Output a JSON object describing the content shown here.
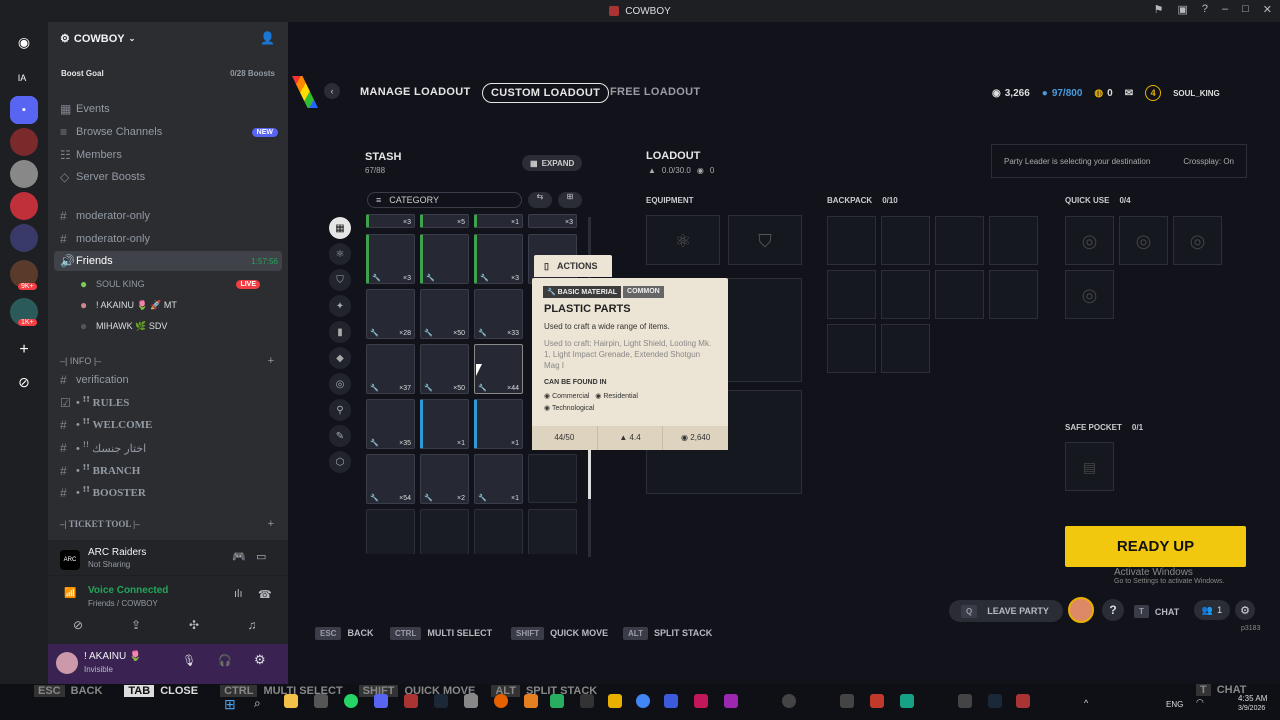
{
  "window": {
    "title": "COWBOY"
  },
  "server": {
    "name": "COWBOY",
    "boost_goal_label": "Boost Goal",
    "boost_count": "0/28 Boosts"
  },
  "sidebar": {
    "top_items": [
      "Events",
      "Browse Channels",
      "Members",
      "Server Boosts"
    ],
    "new_badge": "NEW",
    "channels": [
      "moderator-only",
      "moderator-only"
    ],
    "friends_channel": "Friends",
    "friends_timer": "1:57:56",
    "voice_users": [
      {
        "name": "SOUL KING",
        "badge": "LIVE"
      },
      {
        "name": "! AKAINU 🌷 🚀 MT",
        "badge": ""
      },
      {
        "name": "MIHAWK 🌿 SDV",
        "badge": ""
      }
    ],
    "info_category": "–| INFO |–",
    "info_channels": [
      "verification",
      "• ꜝꜝ RULES",
      "• ꜝꜝ WELCOME",
      "• ꜝꜝ اختار جنسك",
      "• ꜝꜝ BRANCH",
      "• ꜝꜝ BOOSTER"
    ],
    "ticket_category": "–| TICKET TOOL |–"
  },
  "activity": {
    "name": "ARC Raiders",
    "status": "Not Sharing"
  },
  "voice": {
    "status": "Voice Connected",
    "channel": "Friends / COWBOY"
  },
  "user": {
    "name": "! AKAINU 🌷",
    "status": "Invisible"
  },
  "rail_badges": [
    "9K+",
    "1K+"
  ],
  "game": {
    "nav": {
      "manage": "MANAGE LOADOUT",
      "custom": "CUSTOM LOADOUT",
      "free": "FREE LOADOUT"
    },
    "currency": {
      "coins": "3,266",
      "raider": "97/800",
      "tokens": "0",
      "level": "4",
      "username": "SOUL_KING"
    },
    "stash": {
      "title": "STASH",
      "count": "67/88",
      "expand": "EXPAND",
      "category": "CATEGORY"
    },
    "loadout": {
      "title": "LOADOUT",
      "weight": "0.0/30.0",
      "value": "0"
    },
    "party_info": "Party Leader is selecting your destination",
    "crossplay": "Crossplay: On",
    "equipment_label": "EQUIPMENT",
    "backpack_label": "BACKPACK",
    "backpack_count": "0/10",
    "quickuse_label": "QUICK USE",
    "quickuse_count": "0/4",
    "safepocket_label": "SAFE POCKET",
    "safepocket_count": "0/1",
    "ready": "READY UP",
    "activate": "Activate Windows",
    "activate_sub": "Go to Settings to activate Windows.",
    "hints": [
      {
        "key": "ESC",
        "label": "BACK"
      },
      {
        "key": "CTRL",
        "label": "MULTI SELECT"
      },
      {
        "key": "SHIFT",
        "label": "QUICK MOVE"
      },
      {
        "key": "ALT",
        "label": "SPLIT STACK"
      }
    ],
    "leave_key": "Q",
    "leave_party": "LEAVE PARTY",
    "chat_key": "T",
    "chat": "CHAT",
    "party_count": "1",
    "build": "p3183",
    "items_row0": [
      "×3",
      "×5",
      "×1",
      "×3"
    ],
    "items": [
      {
        "count": "×3"
      },
      {
        "count": ""
      },
      {
        "count": "×3"
      },
      {
        "count": "×28"
      },
      {
        "count": "×50"
      },
      {
        "count": "×33"
      },
      {
        "count": "×37"
      },
      {
        "count": "×50"
      },
      {
        "count": "×44"
      },
      {
        "count": "×35"
      },
      {
        "count": "×1"
      },
      {
        "count": "×1"
      },
      {
        "count": "×54"
      },
      {
        "count": "×2"
      },
      {
        "count": "×1"
      }
    ]
  },
  "tooltip": {
    "actions": "ACTIONS",
    "tag1": "BASIC MATERIAL",
    "tag2": "COMMON",
    "name": "PLASTIC PARTS",
    "desc": "Used to craft a wide range of items.",
    "used_for": "Used to craft: Hairpin, Light Shield, Looting Mk. 1, Light Impact Grenade, Extended Shotgun Mag I",
    "found_label": "CAN BE FOUND IN",
    "locations": [
      "Commercial",
      "Residential",
      "Technological"
    ],
    "stack": "44/50",
    "weight": "4.4",
    "value": "2,640"
  },
  "overlay_hints": {
    "esc": "ESC",
    "back": "BACK",
    "tab": "TAB",
    "close": "CLOSE",
    "ctrl": "CTRL",
    "multi": "MULTI SELECT",
    "shift": "SHIFT",
    "quick": "QUICK MOVE",
    "alt": "ALT",
    "split": "SPLIT STACK",
    "t": "T",
    "chat": "CHAT"
  },
  "taskbar": {
    "time": "4:35 AM",
    "date": "3/9/2026",
    "lang": "ENG"
  }
}
